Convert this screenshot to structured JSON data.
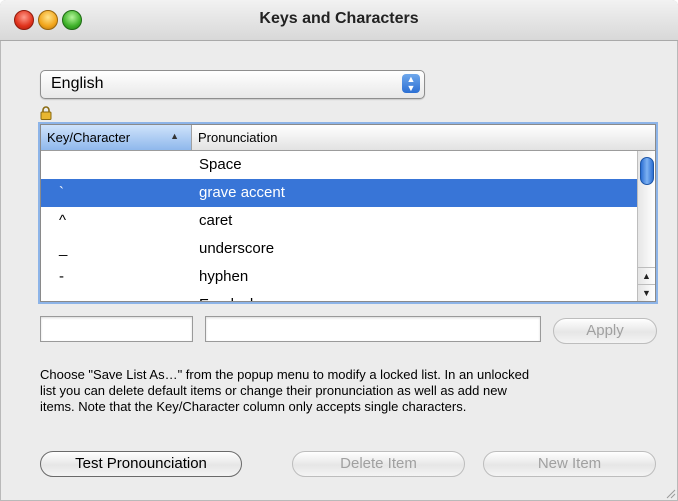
{
  "window": {
    "title": "Keys and Characters"
  },
  "language": {
    "selected": "English"
  },
  "table": {
    "columns": {
      "key": "Key/Character",
      "pronunciation": "Pronunciation"
    },
    "rows": [
      {
        "key": "",
        "pronunciation": "Space",
        "selected": false
      },
      {
        "key": "`",
        "pronunciation": "grave accent",
        "selected": true
      },
      {
        "key": "^",
        "pronunciation": "caret",
        "selected": false
      },
      {
        "key": "_",
        "pronunciation": "underscore",
        "selected": false
      },
      {
        "key": "-",
        "pronunciation": "hyphen",
        "selected": false
      },
      {
        "key": "",
        "pronunciation": "Em dash",
        "selected": false
      }
    ]
  },
  "fields": {
    "key_value": "",
    "pronunciation_value": ""
  },
  "buttons": {
    "apply": "Apply",
    "test_pronunciation": "Test Pronounciation",
    "delete_item": "Delete Item",
    "new_item": "New Item"
  },
  "help_text": {
    "line1": "Choose \"Save List As…\" from the popup menu to modify a locked list. In an unlocked",
    "line2": "list you can delete default items or change their pronunciation as well as add new",
    "line3": "items. Note that the Key/Character column only accepts single characters."
  },
  "colors": {
    "selection": "#3875d7",
    "focus_ring": "#8db4e8",
    "window_bg": "#ececec"
  }
}
